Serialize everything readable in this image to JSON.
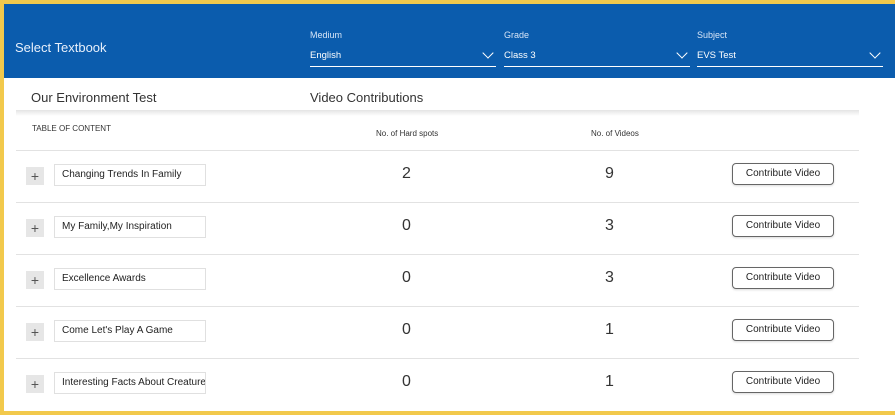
{
  "header": {
    "title": "Select Textbook",
    "medium": {
      "label": "Medium",
      "value": "English"
    },
    "grade": {
      "label": "Grade",
      "value": "Class 3"
    },
    "subject": {
      "label": "Subject",
      "value": "EVS Test"
    }
  },
  "subheader": {
    "book": "Our Environment Test",
    "section": "Video Contributions"
  },
  "columns": {
    "toc": "TABLE OF CONTENT",
    "hard_spots": "No. of Hard spots",
    "videos": "No. of Videos"
  },
  "rows": [
    {
      "chapter": "Changing Trends In Family",
      "hard_spots": "2",
      "videos": "9",
      "button": "Contribute Video"
    },
    {
      "chapter": "My Family,My Inspiration",
      "hard_spots": "0",
      "videos": "3",
      "button": "Contribute Video"
    },
    {
      "chapter": "Excellence Awards",
      "hard_spots": "0",
      "videos": "3",
      "button": "Contribute Video"
    },
    {
      "chapter": "Come Let's Play A Game",
      "hard_spots": "0",
      "videos": "1",
      "button": "Contribute Video"
    },
    {
      "chapter": "Interesting Facts About Creatures",
      "hard_spots": "0",
      "videos": "1",
      "button": "Contribute Video"
    }
  ],
  "expand_symbol": "+",
  "colors": {
    "header_bg": "#0b5cad",
    "frame": "#f2c94c"
  }
}
